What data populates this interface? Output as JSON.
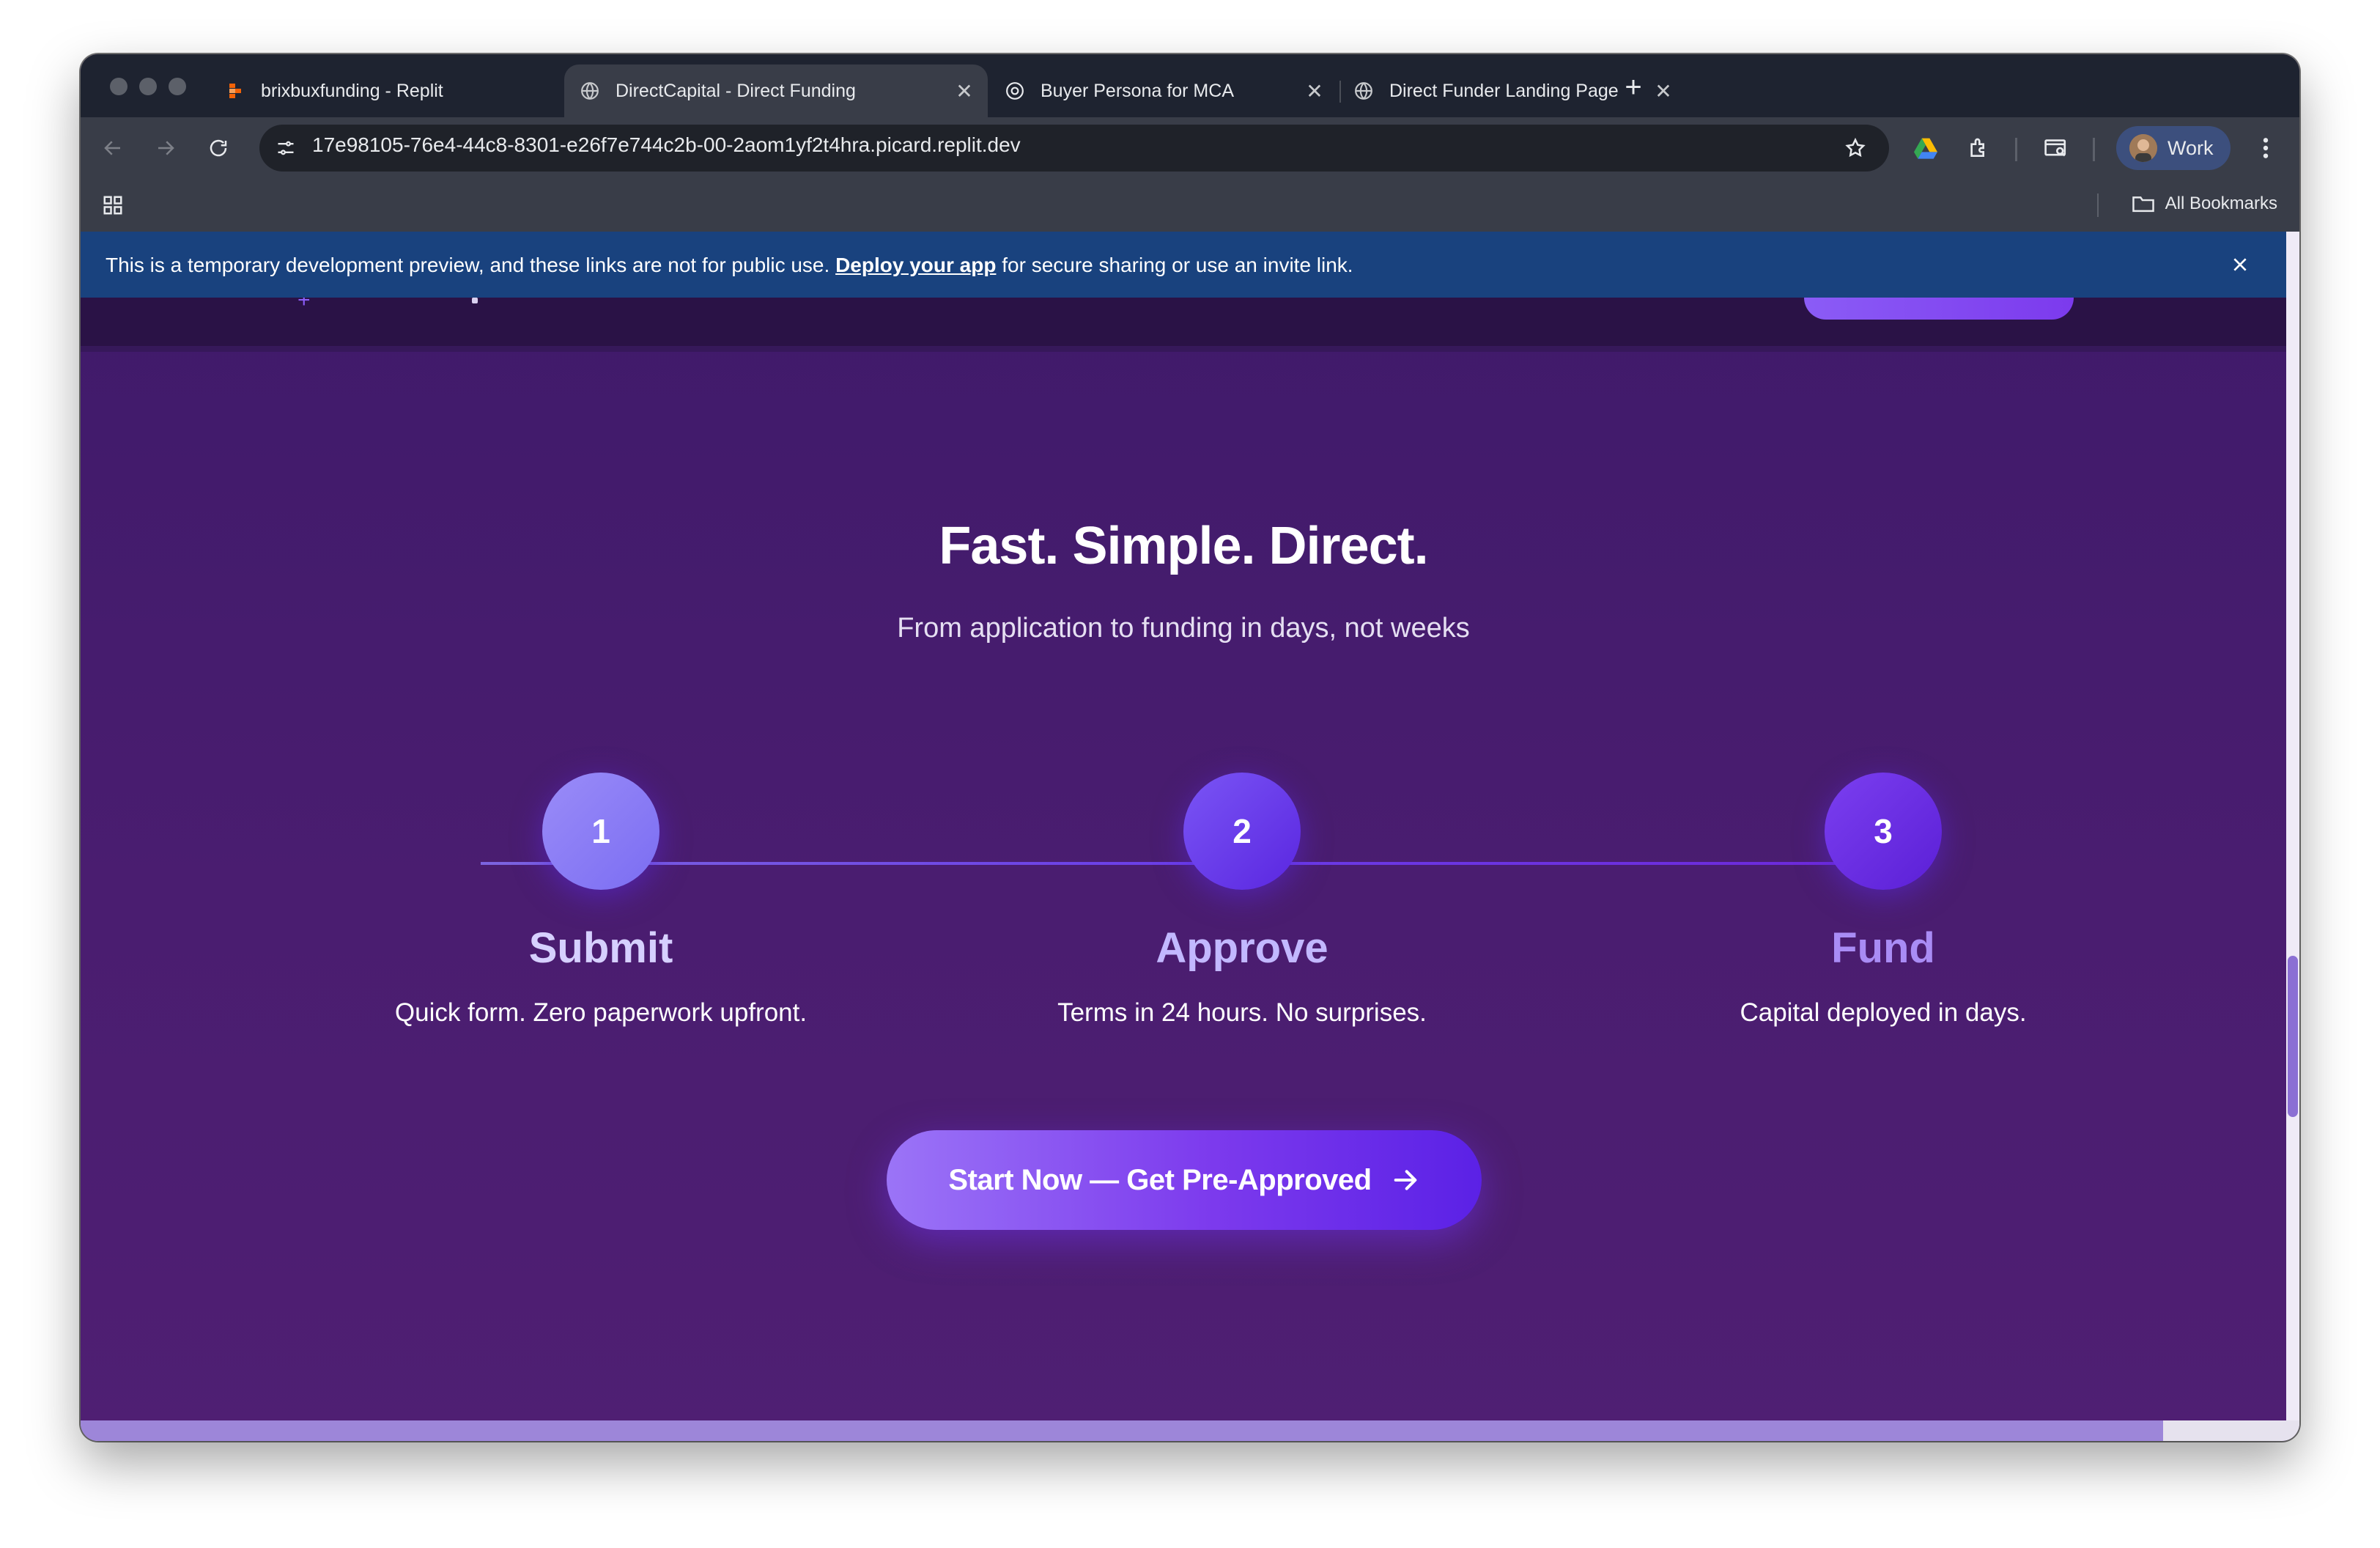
{
  "browser": {
    "tabs": [
      {
        "title": "brixbuxfunding - Replit",
        "icon": "replit-icon",
        "active": false
      },
      {
        "title": "DirectCapital - Direct Funding",
        "icon": "globe-icon",
        "active": true
      },
      {
        "title": "Buyer Persona for MCA",
        "icon": "chatgpt-icon",
        "active": false
      },
      {
        "title": "Direct Funder Landing Page",
        "icon": "globe-icon",
        "active": false
      }
    ],
    "url": "17e98105-76e4-44c8-8301-e26f7e744c2b-00-2aom1yf2t4hra.picard.replit.dev",
    "profile_label": "Work",
    "bookmarks_label": "All Bookmarks"
  },
  "banner": {
    "text_before": "This is a temporary development preview, and these links are not for public use. ",
    "link_text": "Deploy your app",
    "text_after": " for secure sharing or use an invite link."
  },
  "hero": {
    "title": "Fast. Simple. Direct.",
    "subtitle": "From application to funding in days, not weeks"
  },
  "steps": [
    {
      "number": "1",
      "title": "Submit",
      "description": "Quick form. Zero paperwork upfront.",
      "color": "#8b7cf7"
    },
    {
      "number": "2",
      "title": "Approve",
      "description": "Terms in 24 hours. No surprises.",
      "color": "#6d3ef0"
    },
    {
      "number": "3",
      "title": "Fund",
      "description": "Capital deployed in days.",
      "color": "#6a2de8"
    }
  ],
  "cta": {
    "label": "Start Now — Get Pre-Approved",
    "icon": "arrow-right-icon"
  },
  "colors": {
    "page_bg": "#441b6f",
    "accent": "#7c3aed",
    "banner_bg": "#19427e",
    "step_title_1": "#d6d0ff",
    "step_title_2": "#c2b8ff",
    "step_title_3": "#a98cf5"
  }
}
